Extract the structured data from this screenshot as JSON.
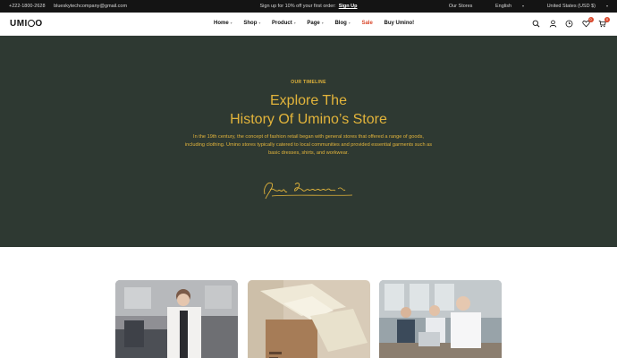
{
  "topbar": {
    "phone": "+222-1800-2628",
    "email": "blueskytechcompany@gmail.com",
    "promo_text": "Sign up for 10% off your first order:",
    "promo_link": "Sign Up",
    "stores": "Our Stores",
    "language": "English",
    "region": "United States (USD $)"
  },
  "header": {
    "logo_prefix": "UMI",
    "logo_suffix": "O",
    "nav": {
      "home": "Home",
      "shop": "Shop",
      "product": "Product",
      "page": "Page",
      "blog": "Blog",
      "sale": "Sale",
      "buy": "Buy Umino!"
    },
    "wishlist_count": "0",
    "cart_count": "0"
  },
  "hero": {
    "eyebrow": "OUR TIMELINE",
    "title_line1": "Explore The",
    "title_line2": "History Of Umino’s Store",
    "description": "In the 19th century, the concept of fashion retail began with general stores that offered a range of goods, including clothing. Umino stores typically catered to local communities and provided essential garments such as basic dresses, shirts, and workwear."
  },
  "colors": {
    "hero_bg": "#2e3932",
    "accent_gold": "#e2b43b",
    "sale_red": "#d9472b",
    "topbar_bg": "#141414"
  },
  "icons": [
    "search-icon",
    "user-icon",
    "clock-icon",
    "heart-icon",
    "cart-icon",
    "chevron-down-icon"
  ]
}
